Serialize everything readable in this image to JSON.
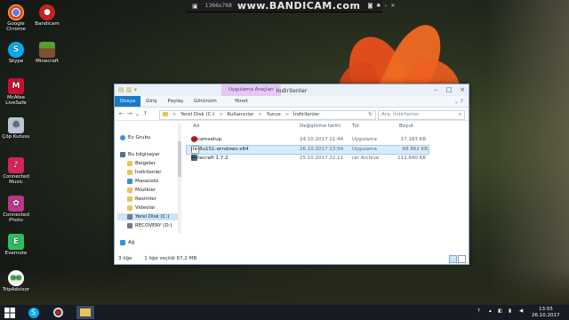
{
  "recorder": {
    "resolution": "1366x768",
    "watermark": "www.BANDICAM.com"
  },
  "desktop_icons": [
    {
      "label": "Google Chrome",
      "icon": "chrome-icon"
    },
    {
      "label": "Bandicam",
      "icon": "bandicam-icon"
    },
    {
      "label": "Skype",
      "icon": "skype-icon"
    },
    {
      "label": "Minecraft",
      "icon": "minecraft-icon"
    },
    {
      "label": "McAfee LiveSafe",
      "icon": "mcafee-icon"
    },
    {
      "label": "Çöp Kutusu",
      "icon": "recycle-bin-icon"
    },
    {
      "label": "Connected Music",
      "icon": "music-icon"
    },
    {
      "label": "Connected Photo",
      "icon": "photo-icon"
    },
    {
      "label": "Evernote",
      "icon": "evernote-icon"
    },
    {
      "label": "TripAdvisor",
      "icon": "tripadvisor-icon"
    }
  ],
  "window": {
    "title": "İndirilenler",
    "tools_badge": "Uygulama Araçları",
    "tabs": [
      "Dosya",
      "Giriş",
      "Paylaş",
      "Görünüm"
    ],
    "manage_tab": "Yönet",
    "address_parts": [
      "Yerel Disk (C:)",
      "Kullanıcılar",
      "Yunus",
      "İndirilenler"
    ],
    "address_sep": ">",
    "search_placeholder": "Ara: İndirilenler",
    "columns": {
      "name": "Ad",
      "date": "Değiştirme tarihi",
      "type": "Tür",
      "size": "Boyut"
    },
    "files": [
      {
        "name": "bdcamsetup",
        "date": "24.10.2017 21:44",
        "type": "Uygulama",
        "size": "17.183 KB",
        "icon": "bandicam-icon",
        "selected": false
      },
      {
        "name": "jre-8u151-windows-x64",
        "date": "26.10.2017 13:54",
        "type": "Uygulama",
        "size": "68.862 KB",
        "icon": "java-icon",
        "selected": true
      },
      {
        "name": "Minecraft 1.7.2",
        "date": "25.10.2017 22:11",
        "type": "rar Archive",
        "size": "112.840 KB",
        "icon": "archive-icon",
        "selected": false
      }
    ],
    "nav": {
      "home_group": "Ev Grubu",
      "this_pc": "Bu bilgisayar",
      "folders": [
        "Belgeler",
        "İndirilenler",
        "Masaüstü",
        "Müzikler",
        "Resimler",
        "Videolar"
      ],
      "drives": [
        "Yerel Disk (C:)",
        "RECOVERY (D:)"
      ],
      "network": "Ağ"
    },
    "status_count": "3 öğe",
    "status_selection": "1 öğe seçildi  67,2 MB"
  },
  "taskbar": {
    "time": "13:55",
    "date": "26.10.2017"
  },
  "colors": {
    "ribbon_active": "#1979ca",
    "selection": "#d9ebf9",
    "taskbar": "#161b24"
  }
}
